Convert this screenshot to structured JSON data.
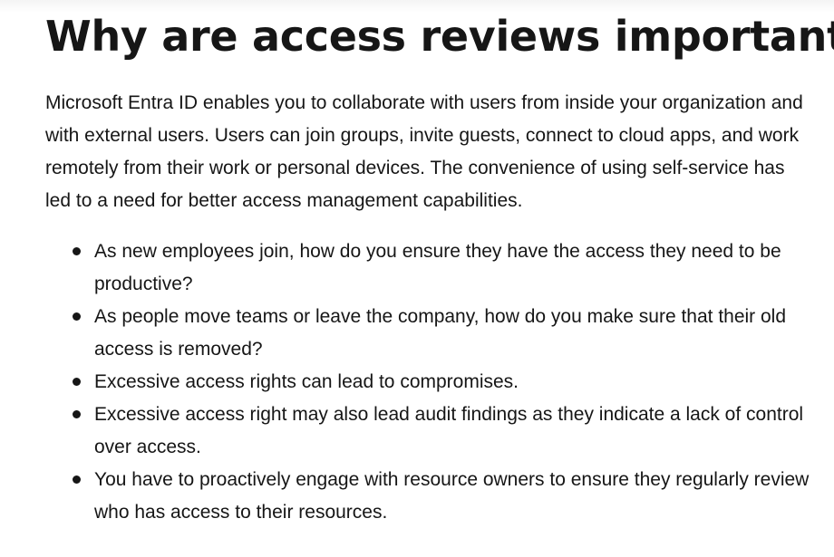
{
  "article": {
    "heading": "Why are access reviews important?",
    "intro": "Microsoft Entra ID enables you to collaborate with users from inside your organization and with external users. Users can join groups, invite guests, connect to cloud apps, and work remotely from their work or personal devices. The convenience of using self-service has led to a need for better access management capabilities.",
    "bullets": [
      "As new employees join, how do you ensure they have the access they need to be productive?",
      "As people move teams or leave the company, how do you make sure that their old access is removed?",
      "Excessive access rights can lead to compromises.",
      "Excessive access right may also lead audit findings as they indicate a lack of control over access.",
      "You have to proactively engage with resource owners to ensure they regularly review who has access to their resources."
    ]
  }
}
